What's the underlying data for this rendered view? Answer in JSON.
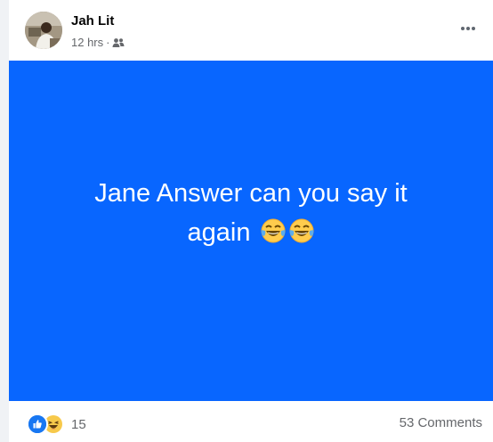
{
  "post": {
    "author": "Jah Lit",
    "time": "12 hrs",
    "separator": "·",
    "audience_icon": "friends-icon",
    "text_line1": "Jane Answer can you say it",
    "text_line2": "again",
    "emojis": [
      "laughing-tears-emoji",
      "laughing-tears-emoji"
    ],
    "background_color": "#0866ff",
    "reaction_count": "15",
    "reactions": [
      "like-icon",
      "haha-icon"
    ],
    "comments_label": "53 Comments"
  },
  "colors": {
    "like_blue": "#1877f2",
    "haha_yellow": "#f7c94b",
    "text_secondary": "#65676b"
  }
}
